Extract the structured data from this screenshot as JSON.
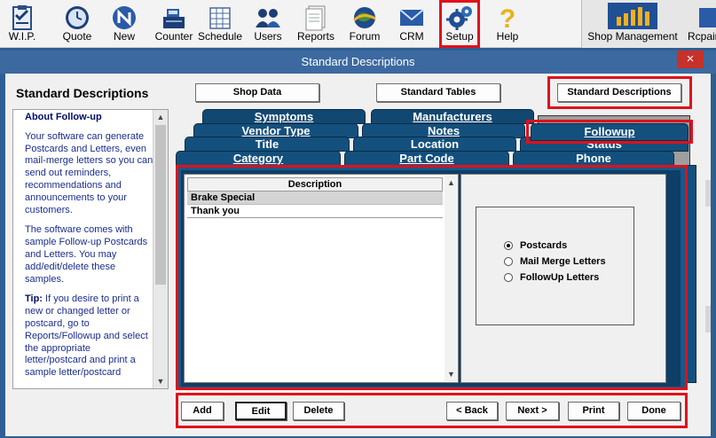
{
  "toolbar": {
    "items": [
      {
        "label": "W.I.P.",
        "icon": "wip-clipboard-icon"
      },
      {
        "label": "Quote",
        "icon": "clock-icon"
      },
      {
        "label": "New",
        "icon": "new-icon"
      },
      {
        "label": "Counter",
        "icon": "cash-register-icon"
      },
      {
        "label": "Schedule",
        "icon": "calendar-icon"
      },
      {
        "label": "Users",
        "icon": "users-icon"
      },
      {
        "label": "Reports",
        "icon": "reports-icon"
      },
      {
        "label": "Forum",
        "icon": "forum-globe-icon"
      },
      {
        "label": "CRM",
        "icon": "crm-envelope-icon"
      },
      {
        "label": "Setup",
        "icon": "gears-icon"
      },
      {
        "label": "Help",
        "icon": "help-question-icon"
      },
      {
        "label": "Shop Management",
        "icon": "bar-chart-icon"
      },
      {
        "label": "Rcpair",
        "icon": "repair-icon"
      }
    ]
  },
  "window": {
    "title": "Standard Descriptions",
    "close": "×"
  },
  "help": {
    "heading": "Standard Descriptions",
    "about_title": "About Follow-up",
    "p1": "Your software can generate Postcards and Letters, even mail-merge letters so you can send out reminders, recommendations and announcements to your customers.",
    "p2": "The software comes with sample Follow-up Postcards and Letters. You may add/edit/delete these samples.",
    "tip_label": "Tip:",
    "tip_text": " If you desire to print a new or changed letter or postcard, go to Reports/Followup and select the appropriate letter/postcard and print a sample letter/postcard"
  },
  "top_buttons": {
    "shop_data": "Shop Data",
    "standard_tables": "Standard Tables",
    "standard_descriptions": "Standard Descriptions"
  },
  "tabs": {
    "row1": [
      "Symptoms",
      "Manufacturers"
    ],
    "row2": [
      "Vendor Type",
      "Notes",
      "Followup"
    ],
    "row3": [
      "Title",
      "Location",
      "Status"
    ],
    "row4": [
      "Category",
      "Part Code",
      "Phone"
    ]
  },
  "grid": {
    "header": "Description",
    "rows": [
      "Brake Special",
      "Thank you"
    ]
  },
  "options": {
    "items": [
      "Postcards",
      "Mail Merge Letters",
      "FollowUp Letters"
    ],
    "selected": "Postcards"
  },
  "bottom_buttons": {
    "add": "Add",
    "edit": "Edit",
    "delete": "Delete",
    "back": "< Back",
    "next": "Next >",
    "print": "Print",
    "done": "Done"
  },
  "colors": {
    "tab": "#14507d",
    "highlight": "#e0101a",
    "help_text": "#1a2d8c"
  }
}
